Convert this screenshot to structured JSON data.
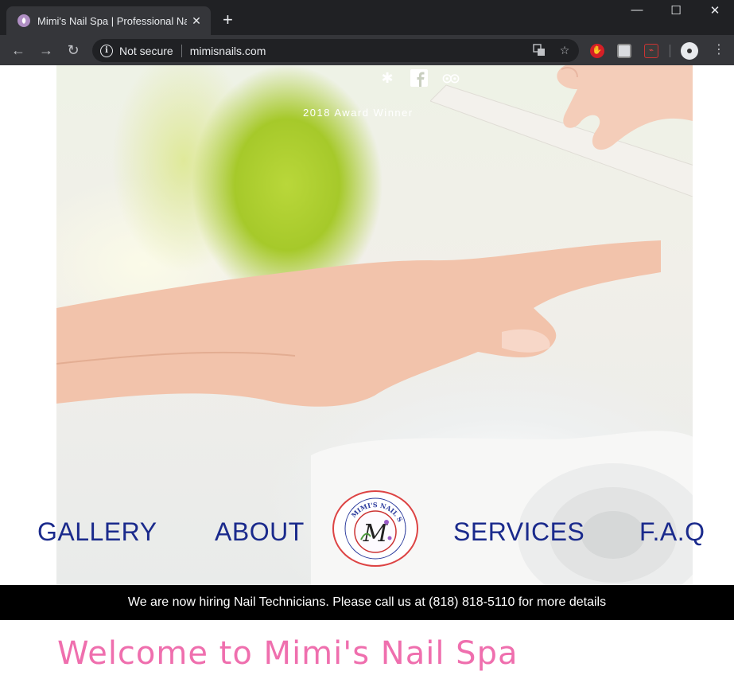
{
  "browser": {
    "tab_title": "Mimi's Nail Spa | Professional Na",
    "tab_close": "✕",
    "new_tab": "+",
    "window_controls": {
      "minimize": "—",
      "maximize": "☐",
      "close": "✕"
    },
    "security_label": "Not secure",
    "url": "mimisnails.com",
    "nav": {
      "back": "←",
      "forward": "→",
      "reload": "↻"
    },
    "icons": [
      "translate-icon",
      "star-icon",
      "stop-extension-icon",
      "cast-extension-icon",
      "pdf-extension-icon",
      "profile-avatar-icon",
      "menu-icon"
    ]
  },
  "site": {
    "social_icons": [
      "yelp-icon",
      "facebook-icon",
      "tripadvisor-icon"
    ],
    "award_text": "2018 Award Winner",
    "nav": {
      "gallery": "GALLERY",
      "about": "ABOUT",
      "services": "SERVICES",
      "faq": "F.A.Q"
    },
    "logo_text": "MIMI'S NAIL SPA",
    "logo_monogram": "M",
    "hiring_banner": "We are now hiring Nail Technicians. Please call us at (818) 818-5110 for more details",
    "welcome_heading": "Welcome to Mimi's Nail Spa",
    "colors": {
      "nav": "#1a2a8c",
      "welcome": "#ef6fae",
      "banner_bg": "#000000",
      "logo_ring": "#dd4444"
    }
  }
}
